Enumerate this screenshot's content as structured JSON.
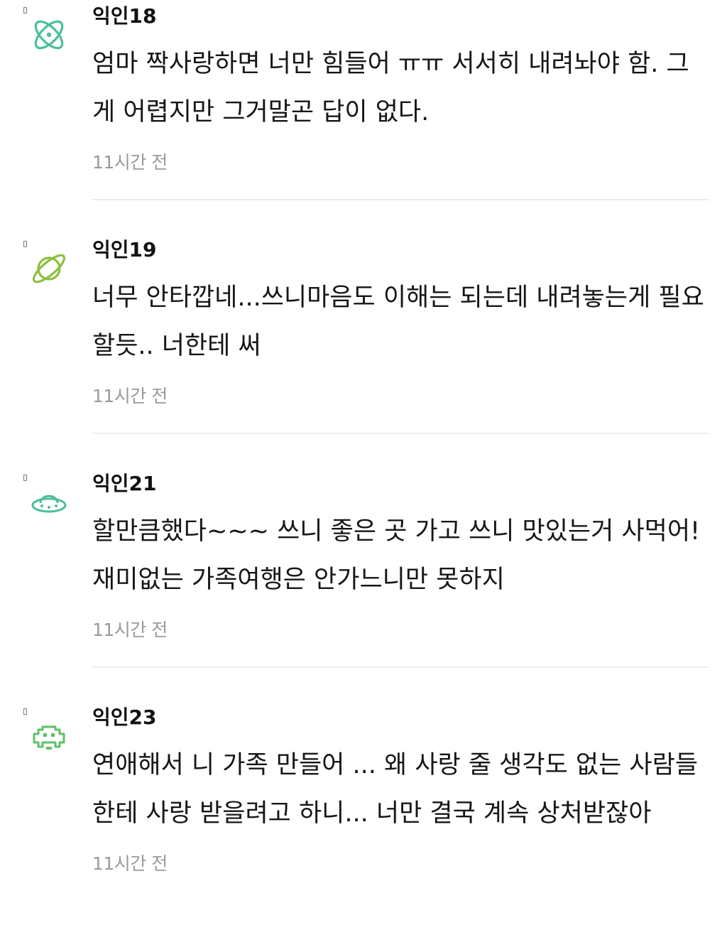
{
  "comments": [
    {
      "author": "익인18",
      "avatar_icon": "atom-icon",
      "avatar_color": "#4bbf9a",
      "text": "엄마 짝사랑하면 너만 힘들어 ㅠㅠ 서서히 내려놔야 함. 그게 어렵지만 그거말곤 답이 없다.",
      "time": "11시간 전"
    },
    {
      "author": "익인19",
      "avatar_icon": "planet-icon",
      "avatar_color": "#8dbf3f",
      "text": "너무 안타깝네...쓰니마음도 이해는 되는데 내려놓는게 필요할듯.. 너한테 써",
      "time": "11시간 전"
    },
    {
      "author": "익인21",
      "avatar_icon": "ufo-icon",
      "avatar_color": "#4bbf9a",
      "text": "할만큼했다~~~ 쓰니 좋은 곳 가고 쓰니 맛있는거 사먹어! 재미없는 가족여행은 안가느니만 못하지",
      "time": "11시간 전"
    },
    {
      "author": "익인23",
      "avatar_icon": "space-invader-icon",
      "avatar_color": "#5cc267",
      "text": "연애해서 니 가족 만들어 ... 왜 사랑 줄 생각도 없는 사람들한테 사랑 받을려고 하니... 너만 결국 계속 상처받잖아",
      "time": "11시간 전"
    }
  ]
}
